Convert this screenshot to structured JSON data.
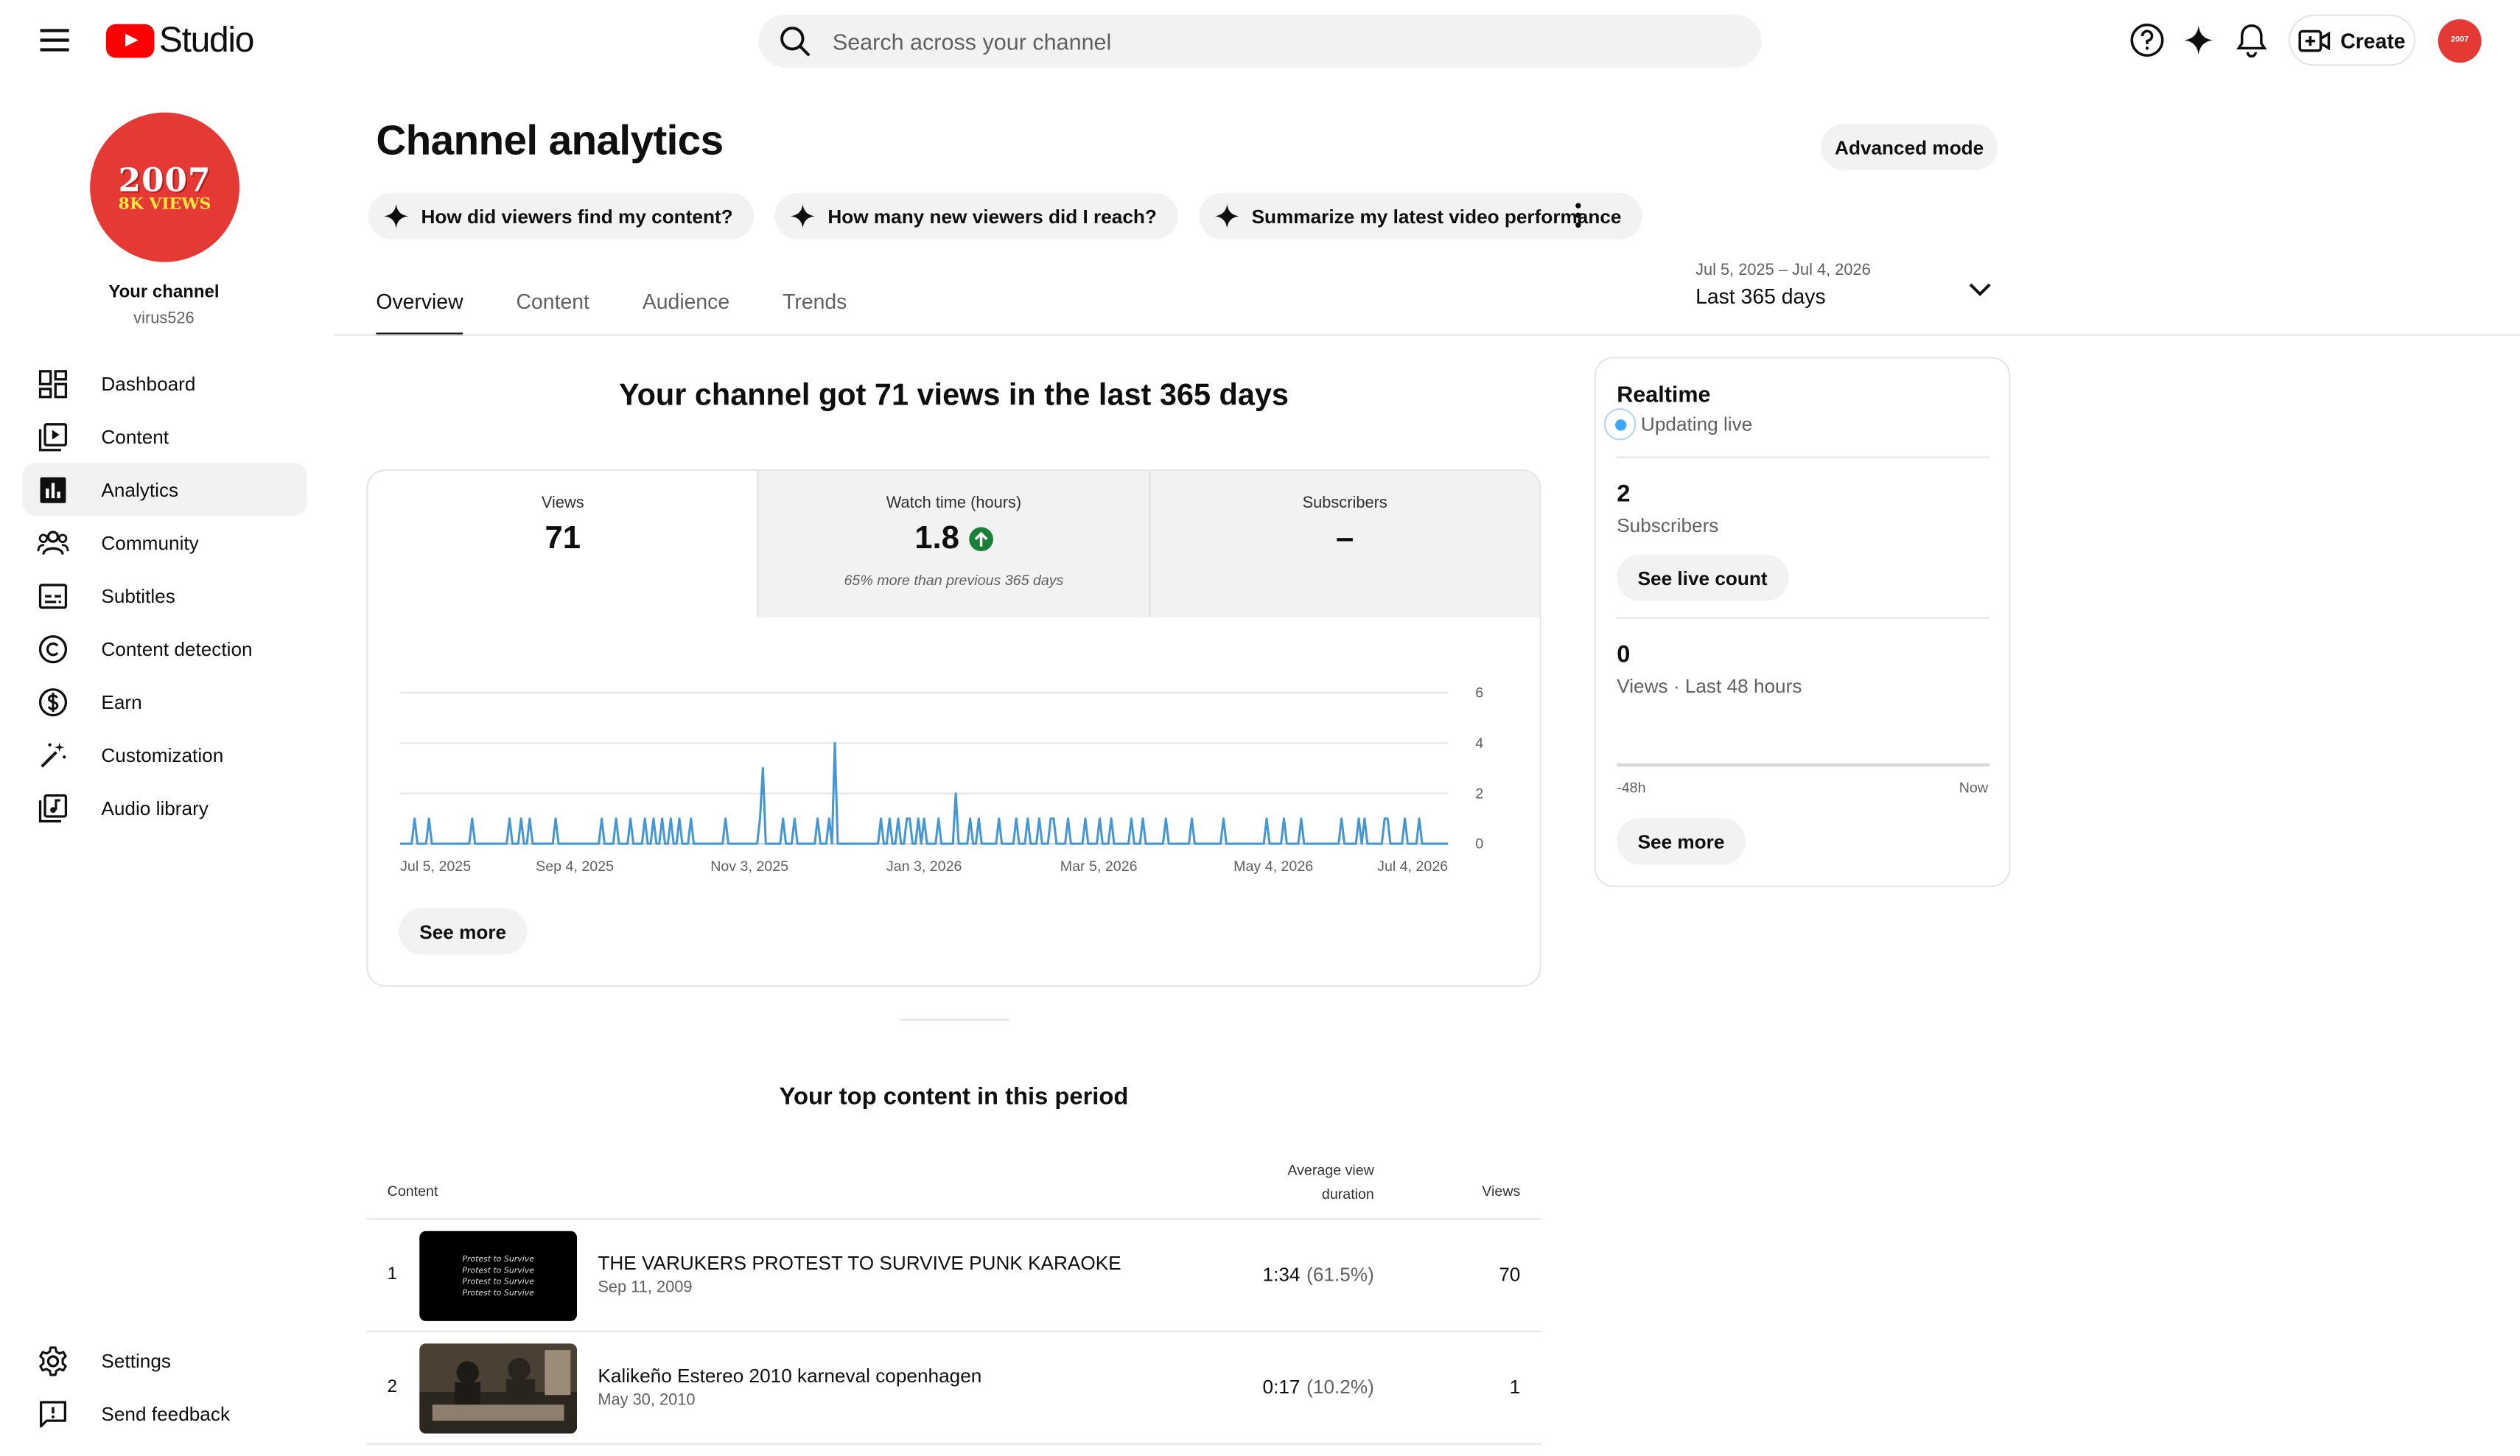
{
  "topbar": {
    "logo_text": "Studio",
    "search_placeholder": "Search across your channel",
    "create_label": "Create",
    "avatar_text": "2007"
  },
  "sidebar": {
    "channel_avatar_year": "2007",
    "channel_avatar_views": "8K VIEWS",
    "channel_title": "Your channel",
    "channel_handle": "virus526",
    "items": [
      {
        "label": "Dashboard",
        "icon": "dashboard-icon"
      },
      {
        "label": "Content",
        "icon": "content-icon"
      },
      {
        "label": "Analytics",
        "icon": "analytics-icon",
        "active": true
      },
      {
        "label": "Community",
        "icon": "community-icon"
      },
      {
        "label": "Subtitles",
        "icon": "subtitles-icon"
      },
      {
        "label": "Content detection",
        "icon": "copyright-icon"
      },
      {
        "label": "Earn",
        "icon": "dollar-icon"
      },
      {
        "label": "Customization",
        "icon": "magic-wand-icon"
      },
      {
        "label": "Audio library",
        "icon": "audio-library-icon"
      }
    ],
    "bottom_items": [
      {
        "label": "Settings",
        "icon": "gear-icon"
      },
      {
        "label": "Send feedback",
        "icon": "feedback-icon"
      }
    ]
  },
  "header": {
    "title": "Channel analytics",
    "advanced_mode_label": "Advanced mode",
    "chips": [
      "How did viewers find my content?",
      "How many new viewers did I reach?",
      "Summarize my latest video performance"
    ],
    "tabs": [
      "Overview",
      "Content",
      "Audience",
      "Trends"
    ],
    "date_range_small": "Jul 5, 2025 – Jul 4, 2026",
    "date_range_main": "Last 365 days"
  },
  "overview": {
    "headline": "Your channel got 71 views in the last 365 days",
    "metrics": [
      {
        "label": "Views",
        "value": "71",
        "note": ""
      },
      {
        "label": "Watch time (hours)",
        "value": "1.8",
        "note": "65% more than previous 365 days"
      },
      {
        "label": "Subscribers",
        "value": "–",
        "note": ""
      }
    ],
    "see_more_label": "See more"
  },
  "chart_data": {
    "type": "line",
    "x_tick_labels": [
      "Jul 5, 2025",
      "Sep 4, 2025",
      "Nov 3, 2025",
      "Jan 3, 2026",
      "Mar 5, 2026",
      "May 4, 2026",
      "Jul 4, 2026"
    ],
    "y_tick_labels": [
      "0",
      "2",
      "4",
      "6"
    ],
    "ylim": [
      0,
      6
    ],
    "grid": true,
    "color": "#4597d3",
    "days": 365,
    "spikes": [
      [
        5,
        1
      ],
      [
        10,
        1
      ],
      [
        25,
        1
      ],
      [
        38,
        1
      ],
      [
        42,
        1
      ],
      [
        45,
        1
      ],
      [
        54,
        1
      ],
      [
        70,
        1
      ],
      [
        75,
        1
      ],
      [
        80,
        1
      ],
      [
        85,
        1
      ],
      [
        88,
        1
      ],
      [
        91,
        1
      ],
      [
        94,
        1
      ],
      [
        97,
        1
      ],
      [
        101,
        1
      ],
      [
        113,
        1
      ],
      [
        125,
        1
      ],
      [
        126,
        3
      ],
      [
        133,
        1
      ],
      [
        137,
        1
      ],
      [
        145,
        1
      ],
      [
        149,
        1
      ],
      [
        151,
        4
      ],
      [
        167,
        1
      ],
      [
        170,
        1
      ],
      [
        173,
        1
      ],
      [
        176,
        1
      ],
      [
        177,
        1
      ],
      [
        180,
        1
      ],
      [
        182,
        1
      ],
      [
        187,
        1
      ],
      [
        193,
        2
      ],
      [
        198,
        1
      ],
      [
        201,
        1
      ],
      [
        208,
        1
      ],
      [
        214,
        1
      ],
      [
        218,
        1
      ],
      [
        222,
        1
      ],
      [
        226,
        1
      ],
      [
        227,
        1
      ],
      [
        232,
        1
      ],
      [
        238,
        1
      ],
      [
        243,
        1
      ],
      [
        247,
        1
      ],
      [
        254,
        1
      ],
      [
        258,
        1
      ],
      [
        266,
        1
      ],
      [
        275,
        1
      ],
      [
        286,
        1
      ],
      [
        301,
        1
      ],
      [
        307,
        1
      ],
      [
        313,
        1
      ],
      [
        327,
        1
      ],
      [
        333,
        1
      ],
      [
        335,
        1
      ],
      [
        342,
        1
      ],
      [
        343,
        1
      ],
      [
        349,
        1
      ],
      [
        354,
        1
      ]
    ]
  },
  "realtime": {
    "title": "Realtime",
    "status": "Updating live",
    "subscribers_value": "2",
    "subscribers_label": "Subscribers",
    "see_live_count_label": "See live count",
    "views_value": "0",
    "views_label": "Views · Last 48 hours",
    "axis_left": "-48h",
    "axis_right": "Now",
    "see_more_label": "See more"
  },
  "top_content": {
    "title": "Your top content in this period",
    "col_content": "Content",
    "col_avd": "Average view duration",
    "col_views": "Views",
    "thumb1_lines": [
      "Protest to Survive",
      "Protest to Survive",
      "Protest to Survive",
      "Protest to Survive"
    ],
    "rows": [
      {
        "index": "1",
        "title": "THE VARUKERS PROTEST TO SURVIVE PUNK KARAOKE",
        "date": "Sep 11, 2009",
        "avd": "1:34",
        "avd_pct": "(61.5%)",
        "views": "70"
      },
      {
        "index": "2",
        "title": "Kalikeño Estereo 2010 karneval copenhagen",
        "date": "May 30, 2010",
        "avd": "0:17",
        "avd_pct": "(10.2%)",
        "views": "1"
      }
    ]
  }
}
